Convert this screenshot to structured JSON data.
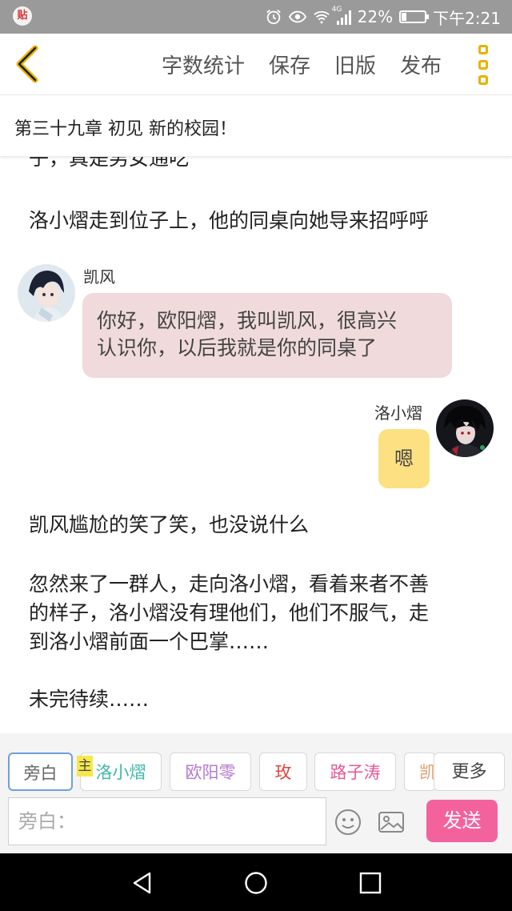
{
  "status_bar": {
    "app_icon_text": "贴",
    "network_label": "4G",
    "battery_text": "22%",
    "battery_level": 0.22,
    "time": "下午2:21"
  },
  "toolbar": {
    "word_count": "字数统计",
    "save": "保存",
    "old_version": "旧版",
    "publish": "发布"
  },
  "chapter": {
    "title": "第三十九章 初见 新的校园！"
  },
  "story": {
    "cut_text": "子，真是男女通吃",
    "para1": "洛小熠走到位子上，他的同桌向她导来招呼呼",
    "dialog_left": {
      "speaker": "凯风",
      "line1": "你好，欧阳熠，我叫凯风，很高兴",
      "line2": "认识你，以后我就是你的同桌了"
    },
    "dialog_right": {
      "speaker": "洛小熠",
      "text": "嗯"
    },
    "para2": "凯风尴尬的笑了笑，也没说什么",
    "para3_line1": "忽然来了一群人，走向洛小熠，看着来者不善",
    "para3_line2": "的样子，洛小熠没有理他们，他们不服气，走",
    "para3_line3": "到洛小熠前面一个巴掌……",
    "para4": "未完待续……"
  },
  "characters": {
    "narration": "旁白",
    "main_badge": "主",
    "c1": "洛小熠",
    "c2": "欧阳零",
    "c3": "玫",
    "c4": "路子涛",
    "c5_partial": "凯",
    "more": "更多"
  },
  "colors": {
    "c1": "#3fb8a8",
    "c2": "#b77ad0",
    "c3": "#e0453a",
    "c4": "#e2599a",
    "c5": "#e0a070",
    "accent": "#e8b200",
    "send": "#f4629d"
  },
  "composer": {
    "placeholder": "旁白：",
    "send": "发送",
    "emoji_icon": "smiley-icon",
    "image_icon": "image-icon"
  }
}
